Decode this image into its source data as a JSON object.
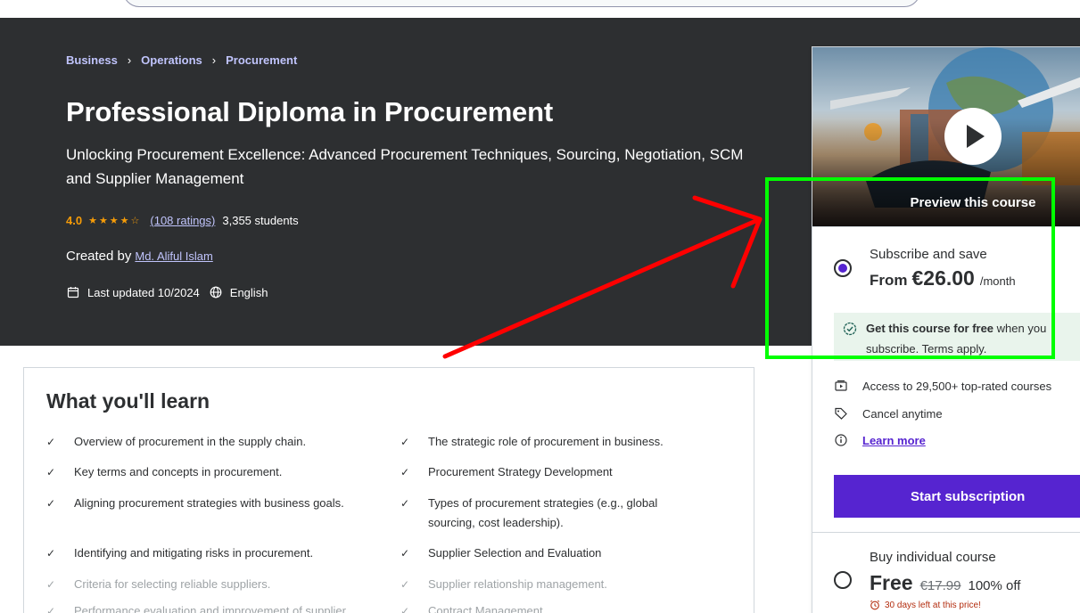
{
  "breadcrumb": [
    "Business",
    "Operations",
    "Procurement"
  ],
  "course": {
    "title": "Professional Diploma in Procurement",
    "subtitle": "Unlocking Procurement Excellence: Advanced Procurement Techniques, Sourcing, Negotiation, SCM and Supplier Management",
    "rating": "4.0",
    "stars": 4,
    "ratings_count": "(108 ratings)",
    "students": "3,355 students",
    "created_by_label": "Created by",
    "instructor": "Md. Aliful Islam",
    "last_updated": "Last updated 10/2024",
    "language": "English"
  },
  "learn": {
    "heading": "What you'll learn",
    "left": [
      "Overview of procurement in the supply chain.",
      "Key terms and concepts in procurement.",
      "Aligning procurement strategies with business goals.",
      "Identifying and mitigating risks in procurement.",
      "Criteria for selecting reliable suppliers.",
      "Performance evaluation and improvement of supplier"
    ],
    "right": [
      "The strategic role of procurement in business.",
      "Procurement Strategy Development",
      "Types of procurement strategies (e.g., global sourcing, cost leadership).",
      "Supplier Selection and Evaluation",
      "Supplier relationship management.",
      "Contract Management"
    ]
  },
  "sidebar": {
    "preview_label": "Preview this course",
    "subscribe": {
      "title": "Subscribe and save",
      "from": "From",
      "price": "€26.00",
      "per": "/month",
      "free_bold": "Get this course for free",
      "free_rest": " when you subscribe. Terms apply."
    },
    "features": [
      "Access to 29,500+ top-rated courses",
      "Cancel anytime"
    ],
    "learn_more": "Learn more",
    "start_button": "Start subscription",
    "buy": {
      "title": "Buy individual course",
      "price": "Free",
      "original": "€17.99",
      "discount": "100% off",
      "deadline": "30 days left at this price!"
    }
  },
  "colors": {
    "hero_bg": "#2d2f31",
    "accent_purple": "#5624d0",
    "link_lilac": "#c0c4fc",
    "star_orange": "#f69c08",
    "annotation_red": "#ff0000",
    "annotation_green": "#00ff00"
  }
}
